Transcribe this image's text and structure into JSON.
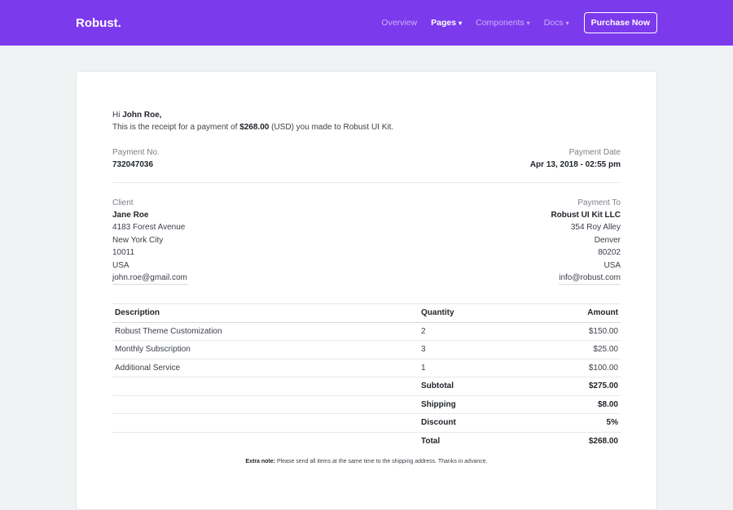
{
  "nav": {
    "brand": "Robust.",
    "links": [
      "Overview",
      "Pages",
      "Components",
      "Docs"
    ],
    "purchase": "Purchase Now"
  },
  "greeting": {
    "hi": "Hi",
    "name": "John Roe,",
    "text_before": "This is the receipt for a payment of",
    "amount": "$268.00",
    "text_after": "(USD) you made to Robust UI Kit."
  },
  "payment": {
    "no_label": "Payment No.",
    "no_value": "732047036",
    "date_label": "Payment Date",
    "date_value": "Apr 13, 2018 - 02:55 pm"
  },
  "client": {
    "label": "Client",
    "name": "Jane Roe",
    "street": "4183 Forest Avenue",
    "city": "New York City",
    "zip": "10011",
    "country": "USA",
    "email": "john.roe@gmail.com"
  },
  "payto": {
    "label": "Payment To",
    "name": "Robust UI Kit LLC",
    "street": "354 Roy Alley",
    "city": "Denver",
    "zip": "80202",
    "country": "USA",
    "email": "info@robust.com"
  },
  "table": {
    "headers": [
      "Description",
      "Quantity",
      "Amount"
    ],
    "rows": [
      {
        "desc": "Robust Theme Customization",
        "qty": "2",
        "amount": "$150.00"
      },
      {
        "desc": "Monthly Subscription",
        "qty": "3",
        "amount": "$25.00"
      },
      {
        "desc": "Additional Service",
        "qty": "1",
        "amount": "$100.00"
      }
    ],
    "summary": [
      {
        "label": "Subtotal",
        "value": "$275.00"
      },
      {
        "label": "Shipping",
        "value": "$8.00"
      },
      {
        "label": "Discount",
        "value": "5%"
      },
      {
        "label": "Total",
        "value": "$268.00"
      }
    ]
  },
  "note": {
    "label": "Extra note:",
    "text": "Please send all items at the same time to the shipping address. Thanks in advance."
  },
  "colors": {
    "navbar": "#7c3aed",
    "background": "#f1f2f4"
  }
}
